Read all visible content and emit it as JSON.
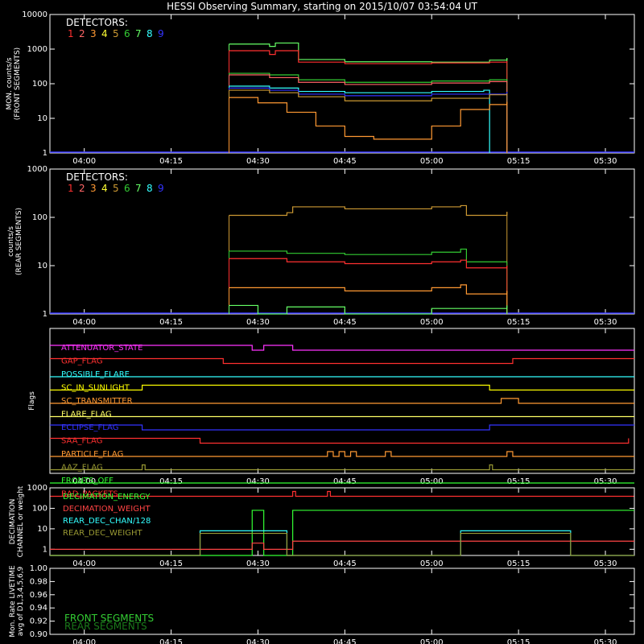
{
  "title": "HESSI Observing Summary, starting on 2015/10/07 03:54:04 UT",
  "colors": {
    "bg": "#000000",
    "fg": "#ffffff",
    "detectors": [
      "#ff3030",
      "#ff6666",
      "#ff9933",
      "#ffff33",
      "#cc9933",
      "#33cc33",
      "#66ff66",
      "#33ffff",
      "#3333ff"
    ],
    "flags": {
      "ATTENUATOR_STATE": "#ff33ff",
      "SAA_FLAG": "#ff3030",
      "POSSIBLE_FLARE": "#33ffff",
      "SC_IN_SUNLIGHT": "#ffff00",
      "SC_TRANSMITTER": "#ff9933",
      "FLARE_FLAG": "#ffff66",
      "ECLIPSE_FLAG": "#3333ff",
      "GAP_FLAG": "#ff3030",
      "PARTICLE_FLAG": "#ff9933",
      "AAZ_FLAG": "#999933",
      "FRONTS_OFF": "#33ff33",
      "BAD_PACKETS": "#ff3030"
    },
    "decimation": {
      "DECIMATION_ENERGY": "#33ff33",
      "DECIMATION_WEIGHT": "#ff4444",
      "REAR_DEC_CHAN/128": "#33ffff",
      "REAR_DEC_WEIGHT": "#999933"
    },
    "front_segments": "#33cc33",
    "rear_segments": "#1a7a1a"
  },
  "time_ticks": [
    "04:00",
    "04:15",
    "04:30",
    "04:45",
    "05:00",
    "05:15",
    "05:30"
  ],
  "detectors_label": "DETECTORS:",
  "detector_numbers": [
    "1",
    "2",
    "3",
    "4",
    "5",
    "6",
    "7",
    "8",
    "9"
  ],
  "chart_data": [
    {
      "type": "line",
      "panel": "front",
      "ylabel": [
        "MON. counts/s",
        "(FRONT SEGMENTS)"
      ],
      "yscale": "log",
      "ylim": [
        1,
        10000
      ],
      "yticks": [
        "1",
        "10",
        "100",
        "1000",
        "10000"
      ],
      "xlim": [
        "03:54:04",
        "05:35:00"
      ],
      "series": [
        {
          "color_index": 6,
          "points": [
            [
              "04:25",
              1400
            ],
            [
              "04:32",
              1200
            ],
            [
              "04:33",
              1500
            ],
            [
              "04:37",
              500
            ],
            [
              "04:45",
              430
            ],
            [
              "05:00",
              420
            ],
            [
              "05:10",
              480
            ],
            [
              "05:13",
              550
            ]
          ]
        },
        {
          "color_index": 0,
          "points": [
            [
              "04:25",
              900
            ],
            [
              "04:32",
              700
            ],
            [
              "04:33",
              900
            ],
            [
              "04:37",
              420
            ],
            [
              "04:45",
              380
            ],
            [
              "05:00",
              400
            ],
            [
              "05:10",
              420
            ],
            [
              "05:13",
              450
            ]
          ]
        },
        {
          "color_index": 5,
          "points": [
            [
              "04:25",
              200
            ],
            [
              "04:32",
              180
            ],
            [
              "04:37",
              130
            ],
            [
              "04:45",
              110
            ],
            [
              "05:00",
              120
            ],
            [
              "05:10",
              130
            ],
            [
              "05:13",
              135
            ]
          ]
        },
        {
          "color_index": 1,
          "points": [
            [
              "04:25",
              180
            ],
            [
              "04:32",
              150
            ],
            [
              "04:37",
              110
            ],
            [
              "04:45",
              95
            ],
            [
              "05:00",
              105
            ],
            [
              "05:10",
              115
            ],
            [
              "05:13",
              120
            ]
          ]
        },
        {
          "color_index": 7,
          "points": [
            [
              "04:25",
              85
            ],
            [
              "04:32",
              75
            ],
            [
              "04:37",
              60
            ],
            [
              "04:45",
              55
            ],
            [
              "05:00",
              60
            ],
            [
              "05:09",
              65
            ],
            [
              "05:10",
              1
            ]
          ]
        },
        {
          "color_index": 8,
          "points": [
            [
              "04:25",
              75
            ],
            [
              "04:32",
              65
            ],
            [
              "04:37",
              50
            ],
            [
              "04:45",
              45
            ],
            [
              "05:00",
              50
            ],
            [
              "05:13",
              58
            ]
          ]
        },
        {
          "color_index": 4,
          "points": [
            [
              "04:25",
              65
            ],
            [
              "04:32",
              55
            ],
            [
              "04:37",
              42
            ],
            [
              "04:45",
              32
            ],
            [
              "05:00",
              38
            ],
            [
              "05:10",
              48
            ],
            [
              "05:13",
              52
            ]
          ]
        },
        {
          "color_index": 2,
          "points": [
            [
              "04:25",
              40
            ],
            [
              "04:30",
              28
            ],
            [
              "04:35",
              15
            ],
            [
              "04:40",
              6
            ],
            [
              "04:45",
              3
            ],
            [
              "04:50",
              2.5
            ],
            [
              "05:00",
              6
            ],
            [
              "05:05",
              18
            ],
            [
              "05:10",
              25
            ],
            [
              "05:13",
              30
            ]
          ]
        }
      ]
    },
    {
      "type": "line",
      "panel": "rear",
      "ylabel": [
        "counts/s",
        "(REAR SEGMENTS)"
      ],
      "yscale": "log",
      "ylim": [
        1,
        1000
      ],
      "yticks": [
        "1",
        "10",
        "100",
        "1000"
      ],
      "xlim": [
        "03:54:04",
        "05:35:00"
      ],
      "series": [
        {
          "color_index": 4,
          "points": [
            [
              "04:25",
              110
            ],
            [
              "04:35",
              125
            ],
            [
              "04:36",
              165
            ],
            [
              "04:45",
              150
            ],
            [
              "05:00",
              165
            ],
            [
              "05:05",
              175
            ],
            [
              "05:06",
              110
            ],
            [
              "05:13",
              130
            ]
          ]
        },
        {
          "color_index": 5,
          "points": [
            [
              "04:25",
              20
            ],
            [
              "04:35",
              18
            ],
            [
              "04:45",
              17
            ],
            [
              "05:00",
              19
            ],
            [
              "05:05",
              22
            ],
            [
              "05:06",
              12
            ],
            [
              "05:13",
              12
            ]
          ]
        },
        {
          "color_index": 0,
          "points": [
            [
              "04:25",
              14
            ],
            [
              "04:35",
              12
            ],
            [
              "04:45",
              11
            ],
            [
              "05:00",
              12
            ],
            [
              "05:05",
              13
            ],
            [
              "05:06",
              9
            ],
            [
              "05:13",
              10
            ]
          ]
        },
        {
          "color_index": 2,
          "points": [
            [
              "04:25",
              3.5
            ],
            [
              "04:35",
              3.5
            ],
            [
              "04:45",
              3.0
            ],
            [
              "05:00",
              3.5
            ],
            [
              "05:05",
              4.0
            ],
            [
              "05:06",
              2.6
            ],
            [
              "05:13",
              3.0
            ]
          ]
        },
        {
          "color_index": 6,
          "points": [
            [
              "04:25",
              1.5
            ],
            [
              "04:30",
              1.0
            ],
            [
              "04:35",
              1.4
            ],
            [
              "04:45",
              1.0
            ],
            [
              "05:00",
              1.3
            ],
            [
              "05:13",
              1.5
            ]
          ]
        }
      ]
    },
    {
      "type": "flags",
      "panel": "flags",
      "ylabel": "Flags",
      "rows": [
        {
          "name": "ATTENUATOR_STATE",
          "segments": [
            [
              "03:54:04",
              1
            ],
            [
              "04:29",
              0
            ],
            [
              "04:31",
              1
            ],
            [
              "04:36",
              0
            ],
            [
              "05:35",
              0
            ]
          ]
        },
        {
          "name": "GAP_FLAG",
          "segments": [
            [
              "03:54:04",
              1
            ],
            [
              "04:24",
              0
            ],
            [
              "05:14",
              1
            ],
            [
              "05:35",
              1
            ]
          ]
        },
        {
          "name": "POSSIBLE_FLARE",
          "segments": [
            [
              "03:54:04",
              0
            ],
            [
              "05:35",
              0
            ]
          ]
        },
        {
          "name": "SC_IN_SUNLIGHT",
          "segments": [
            [
              "03:54:04",
              0
            ],
            [
              "04:10",
              1
            ],
            [
              "05:10",
              0
            ],
            [
              "05:35",
              0
            ]
          ]
        },
        {
          "name": "SC_TRANSMITTER",
          "segments": [
            [
              "03:54:04",
              0
            ],
            [
              "05:12",
              1
            ],
            [
              "05:15",
              0
            ],
            [
              "05:35",
              0
            ]
          ]
        },
        {
          "name": "FLARE_FLAG",
          "segments": [
            [
              "03:54:04",
              0
            ],
            [
              "05:35",
              0
            ]
          ]
        },
        {
          "name": "ECLIPSE_FLAG",
          "segments": [
            [
              "03:54:04",
              1
            ],
            [
              "04:10",
              0
            ],
            [
              "05:10",
              1
            ],
            [
              "05:35",
              1
            ]
          ]
        },
        {
          "name": "SAA_FLAG",
          "segments": [
            [
              "03:54:04",
              1
            ],
            [
              "04:20",
              0
            ],
            [
              "05:34",
              1
            ]
          ]
        },
        {
          "name": "PARTICLE_FLAG",
          "segments": [
            [
              "03:54:04",
              0
            ],
            [
              "04:42",
              1
            ],
            [
              "04:43",
              0
            ],
            [
              "04:44",
              1
            ],
            [
              "04:45",
              0
            ],
            [
              "04:46",
              1
            ],
            [
              "04:47",
              0
            ],
            [
              "04:52",
              1
            ],
            [
              "04:53",
              0
            ],
            [
              "05:13",
              1
            ],
            [
              "05:14",
              0
            ],
            [
              "05:35",
              0
            ]
          ]
        },
        {
          "name": "AAZ_FLAG",
          "segments": [
            [
              "03:54:04",
              0
            ],
            [
              "04:10",
              1
            ],
            [
              "04:10:30",
              0
            ],
            [
              "05:10",
              1
            ],
            [
              "05:10:30",
              0
            ],
            [
              "05:35",
              0
            ]
          ]
        },
        {
          "name": "FRONTS_OFF",
          "segments": [
            [
              "03:54:04",
              0
            ],
            [
              "05:35",
              0
            ]
          ]
        },
        {
          "name": "BAD_PACKETS",
          "segments": [
            [
              "03:54:04",
              0
            ],
            [
              "04:36",
              1
            ],
            [
              "04:36:30",
              0
            ],
            [
              "04:42",
              1
            ],
            [
              "04:42:30",
              0
            ],
            [
              "05:35",
              0
            ]
          ]
        }
      ]
    },
    {
      "type": "line",
      "panel": "decimation",
      "ylabel": [
        "DECIMATION",
        "CHANNEL or weight"
      ],
      "yscale": "log",
      "ylim": [
        0.5,
        1000
      ],
      "yticks": [
        "1",
        "10",
        "100",
        "1000"
      ],
      "series": [
        {
          "name": "DECIMATION_ENERGY",
          "points": [
            [
              "03:54:04",
              0.5
            ],
            [
              "04:29",
              0.5
            ],
            [
              "04:29",
              80
            ],
            [
              "04:31",
              80
            ],
            [
              "04:31",
              0.5
            ],
            [
              "04:36",
              0.5
            ],
            [
              "04:36",
              80
            ],
            [
              "05:35",
              80
            ]
          ]
        },
        {
          "name": "DECIMATION_WEIGHT",
          "points": [
            [
              "03:54:04",
              1
            ],
            [
              "04:29",
              1
            ],
            [
              "04:29",
              2
            ],
            [
              "04:31",
              2
            ],
            [
              "04:31",
              1
            ],
            [
              "04:36",
              1
            ],
            [
              "04:36",
              2.5
            ],
            [
              "05:35",
              2.5
            ]
          ]
        },
        {
          "name": "REAR_DEC_CHAN/128",
          "points": [
            [
              "03:54:04",
              0.5
            ],
            [
              "04:20",
              0.5
            ],
            [
              "04:20",
              8
            ],
            [
              "04:35",
              8
            ],
            [
              "04:35",
              0.5
            ],
            [
              "05:05",
              0.5
            ],
            [
              "05:05",
              8
            ],
            [
              "05:24",
              8
            ],
            [
              "05:24",
              0.5
            ],
            [
              "05:35",
              0.5
            ]
          ]
        },
        {
          "name": "REAR_DEC_WEIGHT",
          "points": [
            [
              "03:54:04",
              0.5
            ],
            [
              "04:20",
              0.5
            ],
            [
              "04:20",
              6
            ],
            [
              "04:35",
              6
            ],
            [
              "04:35",
              0.5
            ],
            [
              "05:05",
              0.5
            ],
            [
              "05:05",
              6
            ],
            [
              "05:24",
              6
            ],
            [
              "05:24",
              0.5
            ],
            [
              "05:35",
              0.5
            ]
          ]
        }
      ]
    },
    {
      "type": "line",
      "panel": "livetime",
      "ylabel": [
        "Mon. Rate LIVETIME",
        "avg of D1,3,4,5,6,9"
      ],
      "ylim": [
        0.9,
        1.0
      ],
      "yticks": [
        "0.90",
        "0.92",
        "0.94",
        "0.96",
        "0.98",
        "1.00"
      ],
      "series": [
        {
          "name": "FRONT SEGMENTS",
          "points": []
        },
        {
          "name": "REAR SEGMENTS",
          "points": []
        }
      ]
    }
  ]
}
